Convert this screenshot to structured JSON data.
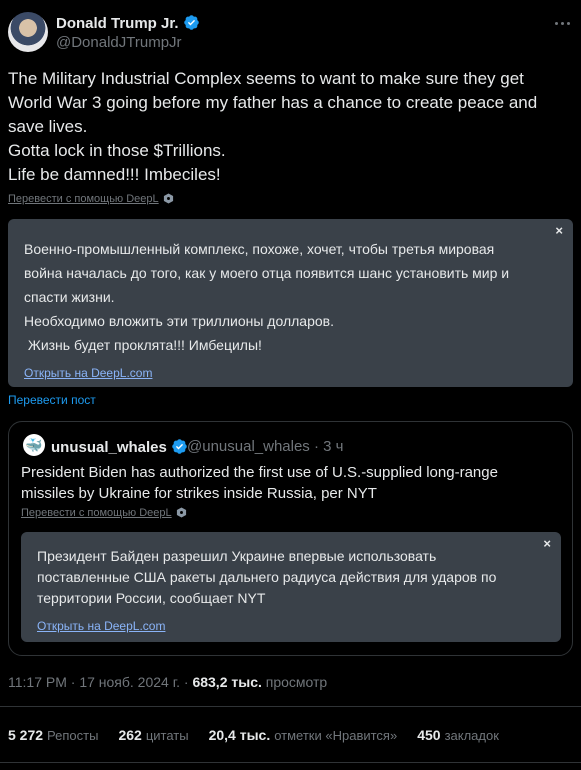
{
  "author": {
    "name": "Donald Trump Jr.",
    "handle": "@DonaldJTrumpJr"
  },
  "tweet": {
    "text": "The Military Industrial Complex seems to want to make sure they get\nWorld War 3 going before my father has a chance to create peace and\nsave lives.\nGotta lock in those $Trillions.\nLife be damned!!! Imbeciles!",
    "deepl_label": "Перевести с помощью DeepL",
    "translation": "Военно-промышленный комплекс, похоже, хочет, чтобы третья мировая\nвойна началась до того, как у моего отца появится шанс установить мир и\nспасти жизни.\nНеобходимо вложить эти триллионы долларов.\n Жизнь будет проклята!!! Имбецилы!",
    "translation_close": "×",
    "open_deepl": "Открыть на DeepL.com",
    "translate_post": "Перевести пост"
  },
  "quote": {
    "name": "unusual_whales",
    "handle_time": "@unusual_whales · 3 ч",
    "text": "President Biden has authorized the first use of U.S.-supplied long-range\nmissiles by Ukraine for strikes inside Russia, per NYT",
    "deepl_label": "Перевести с помощью DeepL",
    "translation": "Президент Байден разрешил Украине впервые использовать\nпоставленные США ракеты дальнего радиуса действия для ударов по\nтерритории России, сообщает NYT",
    "translation_close": "×",
    "open_deepl": "Открыть на DeepL.com"
  },
  "meta": {
    "time_date": "11:17 PM · 17 нояб. 2024 г. · ",
    "views_count": "683,2 тыс.",
    "views_label": " просмотр"
  },
  "stats": [
    {
      "count": "5 272",
      "label": "Репосты"
    },
    {
      "count": "262",
      "label": "цитаты"
    },
    {
      "count": "20,4 тыс.",
      "label": "отметки «Нравится»"
    },
    {
      "count": "450",
      "label": "закладок"
    }
  ],
  "icons": {
    "verified": "verified-badge-icon",
    "more": "more-options-icon",
    "deepl": "deepl-icon",
    "whale": "whale-icon"
  },
  "colors": {
    "accent": "#1d9bf0",
    "background": "#000000",
    "translation_box": "#3a4149",
    "secondary_text": "#71767b"
  }
}
